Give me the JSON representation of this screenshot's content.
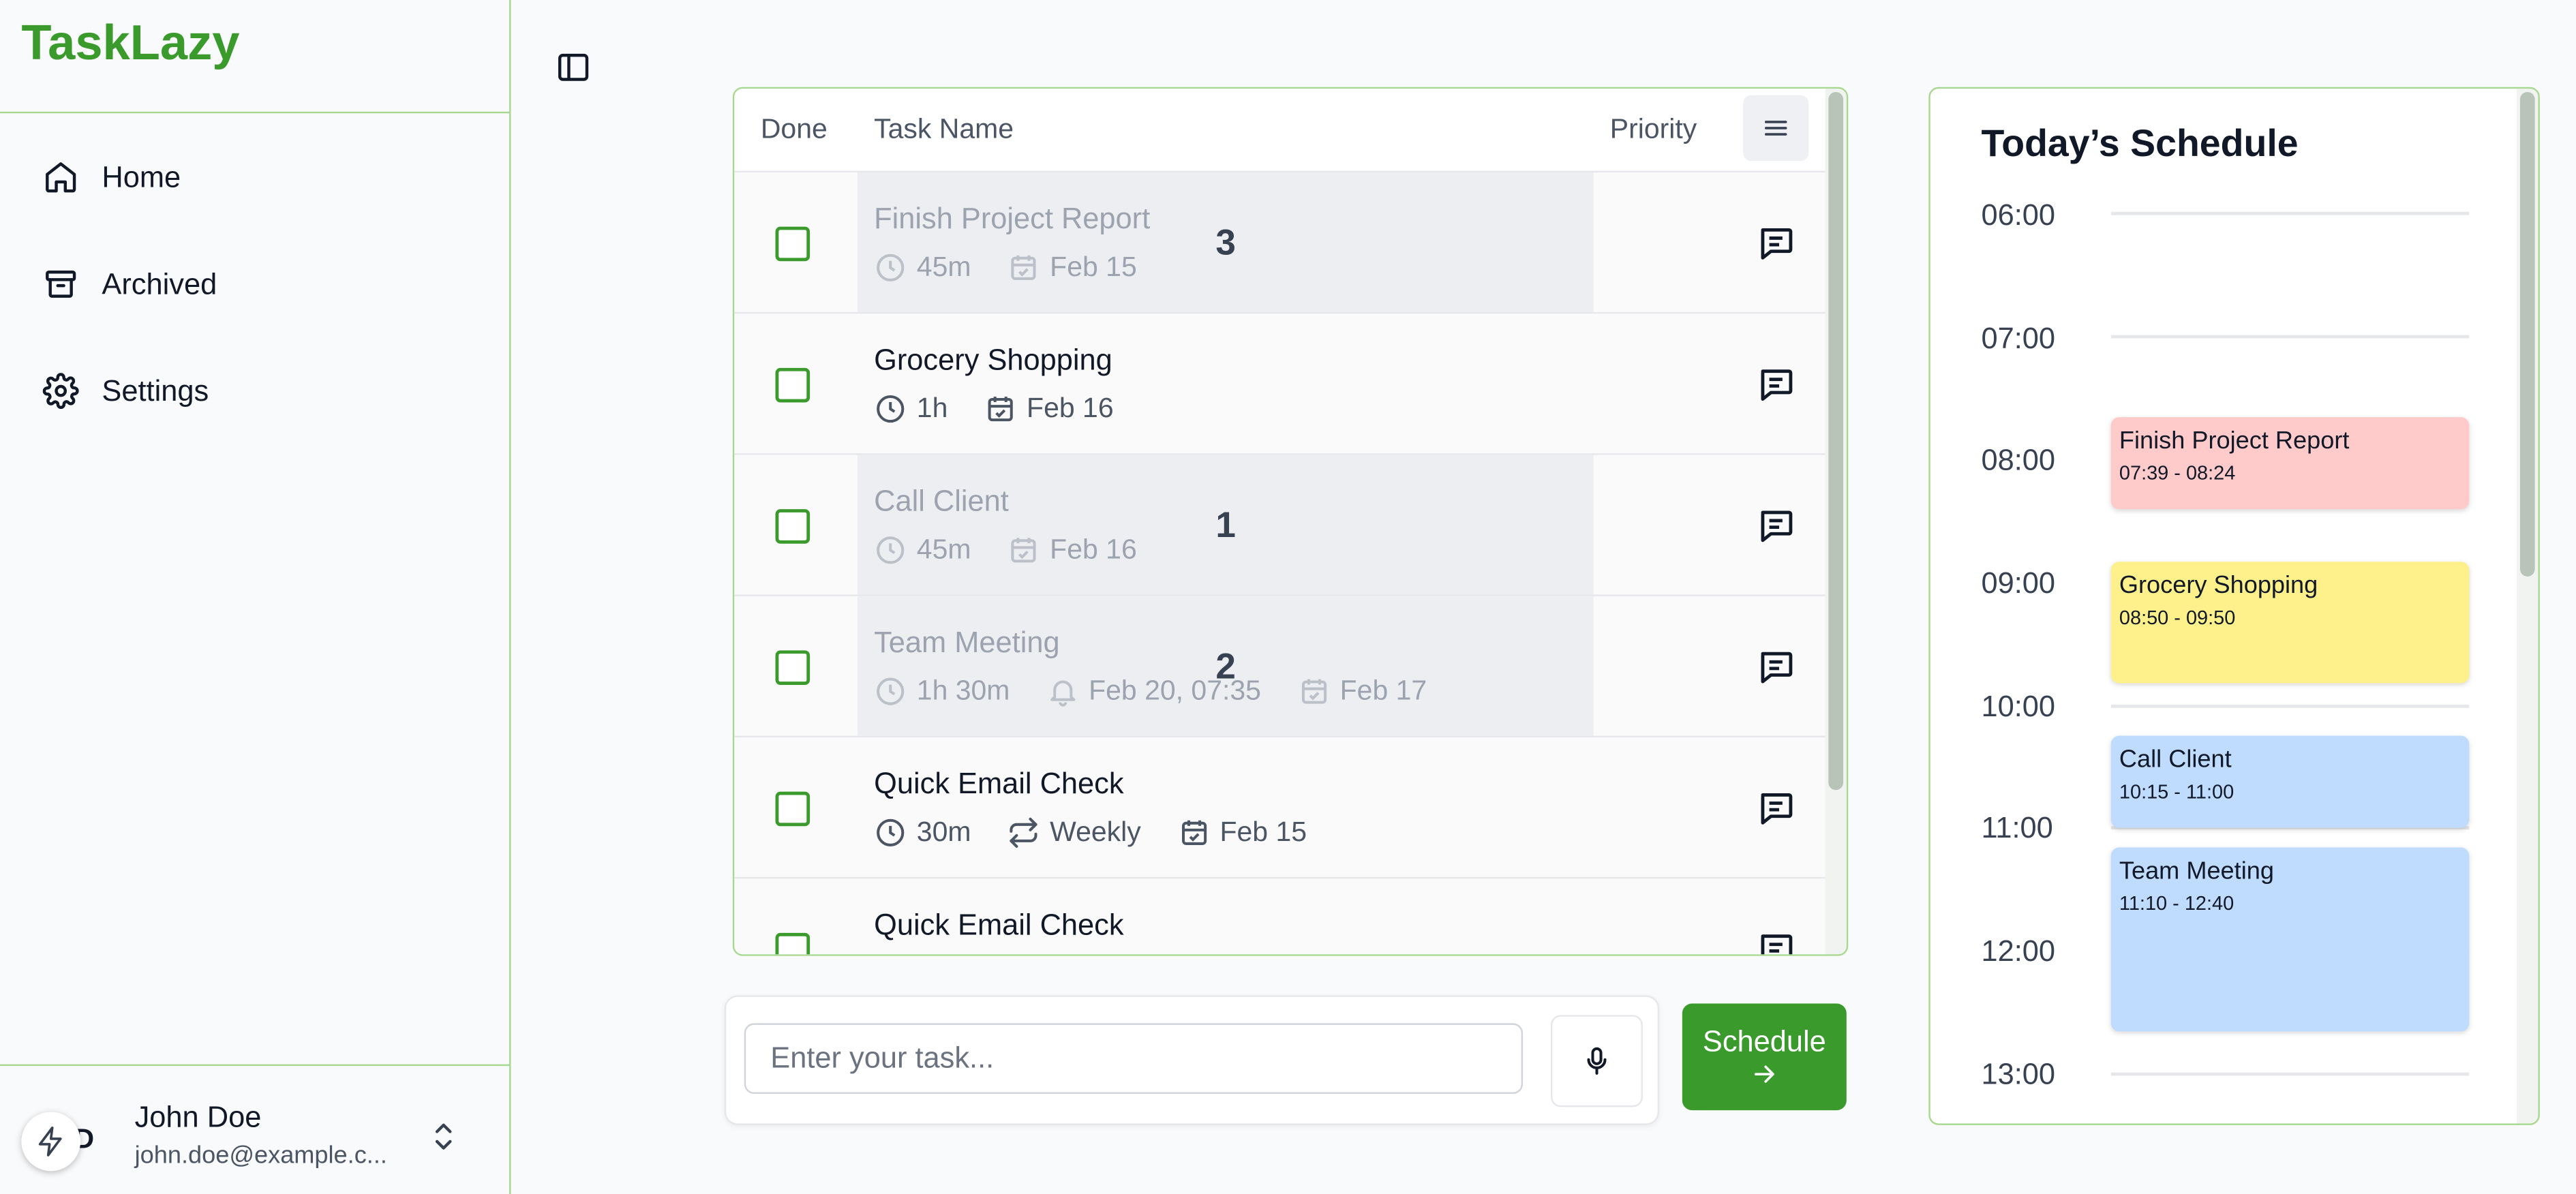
{
  "app": {
    "brand": "TaskLazy",
    "brand_color": "#3a9a2c"
  },
  "sidebar": {
    "items": [
      {
        "label": "Home",
        "icon": "home-icon"
      },
      {
        "label": "Archived",
        "icon": "archive-icon"
      },
      {
        "label": "Settings",
        "icon": "gear-icon"
      }
    ],
    "user": {
      "avatar_icon": "lightning-icon",
      "avatar_letter": "D",
      "name": "John Doe",
      "email": "john.doe@example.c..."
    }
  },
  "tasks": {
    "columns": {
      "done": "Done",
      "name": "Task Name",
      "priority": "Priority"
    },
    "rows": [
      {
        "name": "Finish Project Report",
        "duration": "45m",
        "due": "Feb 15",
        "order": "3",
        "scheduled": true
      },
      {
        "name": "Grocery Shopping",
        "duration": "1h",
        "due": "Feb 16",
        "scheduled": false
      },
      {
        "name": "Call Client",
        "duration": "45m",
        "due": "Feb 16",
        "order": "1",
        "scheduled": true
      },
      {
        "name": "Team Meeting",
        "duration": "1h 30m",
        "reminder": "Feb 20, 07:35",
        "due": "Feb 17",
        "order": "2",
        "scheduled": true
      },
      {
        "name": "Quick Email Check",
        "duration": "30m",
        "repeat": "Weekly",
        "due": "Feb 15",
        "scheduled": false
      },
      {
        "name": "Quick Email Check",
        "scheduled": false
      }
    ]
  },
  "composer": {
    "placeholder": "Enter your task...",
    "schedule_label": "Schedule"
  },
  "schedule": {
    "title": "Today’s Schedule",
    "hours": [
      "06:00",
      "07:00",
      "08:00",
      "09:00",
      "10:00",
      "11:00",
      "12:00",
      "13:00"
    ],
    "events": [
      {
        "title": "Finish Project Report",
        "time": "07:39 - 08:24",
        "color": "#fecaca"
      },
      {
        "title": "Grocery Shopping",
        "time": "08:50 - 09:50",
        "color": "#fef08a"
      },
      {
        "title": "Call Client",
        "time": "10:15 - 11:00",
        "color": "#bfdbfe"
      },
      {
        "title": "Team Meeting",
        "time": "11:10 - 12:40",
        "color": "#bfdbfe"
      }
    ]
  }
}
